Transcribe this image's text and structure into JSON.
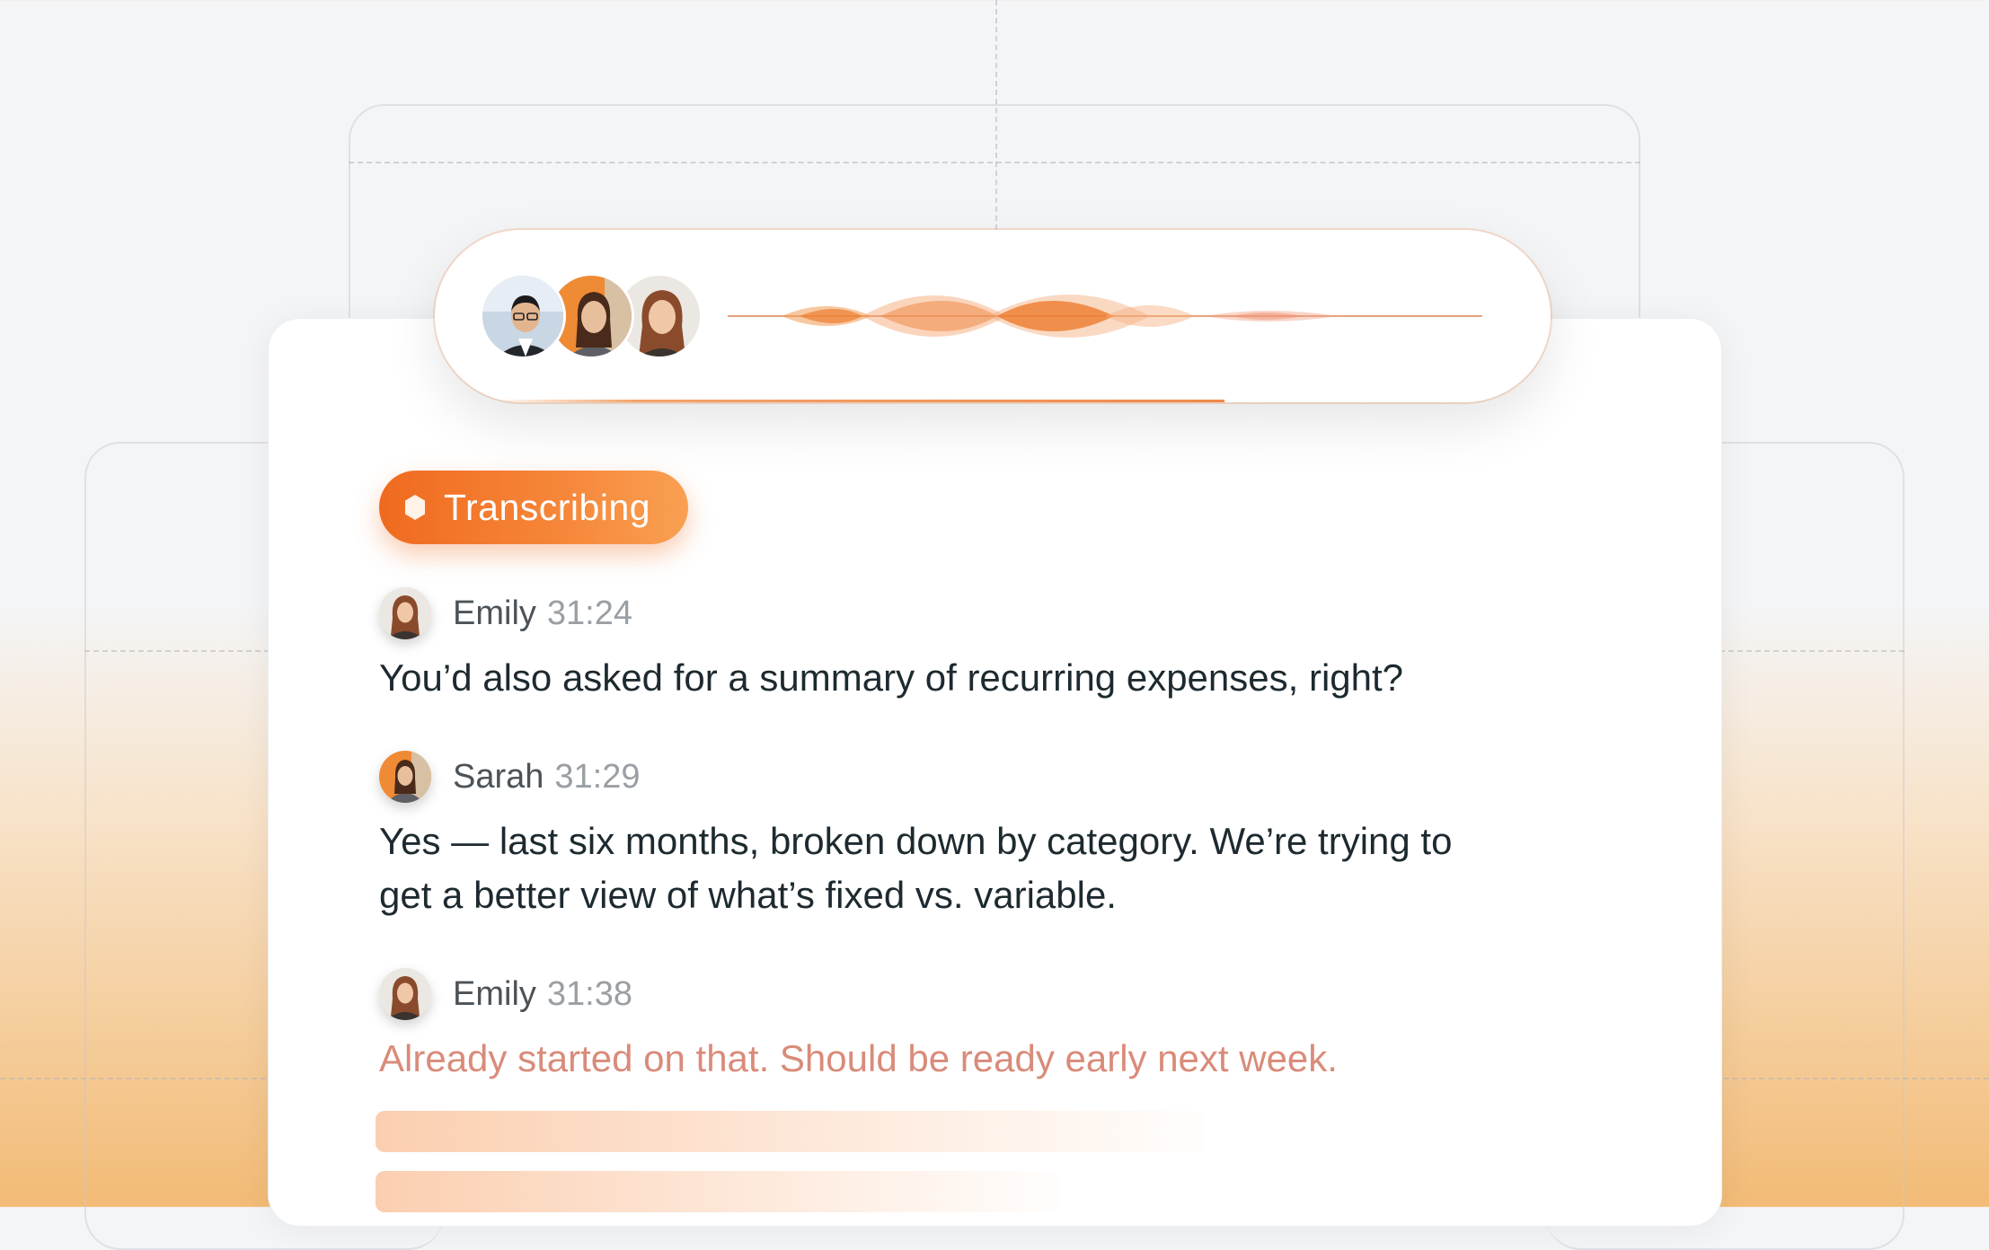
{
  "call": {
    "participants": [
      {
        "name": "participant-1",
        "icon": "avatar-man-glasses"
      },
      {
        "name": "participant-2",
        "icon": "avatar-sarah"
      },
      {
        "name": "participant-3",
        "icon": "avatar-emily"
      }
    ],
    "progress_percent": 73,
    "accent": "#f08a4b"
  },
  "status": {
    "label": "Transcribing",
    "icon": "hexagon-icon",
    "color": "#ef6a1f"
  },
  "transcript": [
    {
      "speaker": "Emily",
      "time": "31:24",
      "text": "You’d also asked for a summary of recurring expenses, right?",
      "live": false
    },
    {
      "speaker": "Sarah",
      "time": "31:29",
      "text": "Yes — last six months, broken down by category. We’re trying to get a better view of what’s fixed vs. variable.",
      "live": false
    },
    {
      "speaker": "Emily",
      "time": "31:38",
      "text": "Already started on that. Should be ready early next week.",
      "live": true
    }
  ],
  "colors": {
    "live_text": "#d98b7a",
    "body_text": "#1d2a30",
    "timestamp": "#9a9fa4"
  }
}
